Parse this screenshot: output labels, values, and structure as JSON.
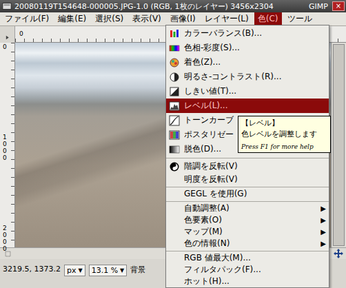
{
  "window": {
    "title": "20080119T154648-000005.JPG-1.0 (RGB, 1枚のレイヤー) 3456x2304",
    "app": "GIMP",
    "controls": [
      "×"
    ]
  },
  "menubar": [
    {
      "label": "ファイル(F)",
      "selected": false
    },
    {
      "label": "編集(E)",
      "selected": false
    },
    {
      "label": "選択(S)",
      "selected": false
    },
    {
      "label": "表示(V)",
      "selected": false
    },
    {
      "label": "画像(I)",
      "selected": false
    },
    {
      "label": "レイヤー(L)",
      "selected": false
    },
    {
      "label": "色(C)",
      "selected": true
    },
    {
      "label": "ツール",
      "selected": false
    }
  ],
  "rulers": {
    "top": [
      "0"
    ],
    "left": [
      "0",
      "1000",
      "2000"
    ]
  },
  "status_bar": {
    "coords": "3219.5, 1373.2",
    "unit": "px",
    "unit_arrow": "▼",
    "zoom": "13.1 %",
    "zoom_arrow": "▼",
    "layer": "背景"
  },
  "color_menu": {
    "items": [
      {
        "kind": "icon-item",
        "label": "カラーバランス(B)...",
        "selected": false
      },
      {
        "kind": "icon-item",
        "label": "色相-彩度(S)...",
        "selected": false
      },
      {
        "kind": "icon-item",
        "label": "着色(Z)...",
        "selected": false
      },
      {
        "kind": "icon-item",
        "label": "明るさ-コントラスト(R)...",
        "selected": false
      },
      {
        "kind": "icon-item",
        "label": "しきい値(T)...",
        "selected": false
      },
      {
        "kind": "icon-item",
        "label": "レベル(L)...",
        "selected": true
      },
      {
        "kind": "icon-item",
        "label": "トーンカーブ",
        "selected": false
      },
      {
        "kind": "icon-item",
        "label": "ポスタリゼー",
        "selected": false
      },
      {
        "kind": "icon-item",
        "label": "脱色(D)...",
        "selected": false
      },
      {
        "kind": "separator"
      },
      {
        "kind": "icon-item",
        "label": "階調を反転(V)",
        "selected": false
      },
      {
        "kind": "item",
        "label": "明度を反転(V)",
        "selected": false
      },
      {
        "kind": "separator"
      },
      {
        "kind": "item",
        "label": "GEGL を使用(G)",
        "selected": false
      },
      {
        "kind": "separator"
      },
      {
        "kind": "submenu",
        "label": "自動調整(A)",
        "arrow": "▶",
        "selected": false
      },
      {
        "kind": "submenu",
        "label": "色要素(O)",
        "arrow": "▶",
        "selected": false
      },
      {
        "kind": "submenu",
        "label": "マップ(M)",
        "arrow": "▶",
        "selected": false
      },
      {
        "kind": "submenu",
        "label": "色の情報(N)",
        "arrow": "▶",
        "selected": false
      },
      {
        "kind": "separator"
      },
      {
        "kind": "item",
        "label": "RGB 値最大(M)...",
        "selected": false
      },
      {
        "kind": "item",
        "label": "フィルタパック(F)...",
        "selected": false
      },
      {
        "kind": "item",
        "label": "ホット(H)...",
        "selected": false
      }
    ]
  },
  "tooltip": {
    "title": "【レベル】",
    "text": "色レベルを調整します",
    "hint": "Press F1 for more help"
  }
}
